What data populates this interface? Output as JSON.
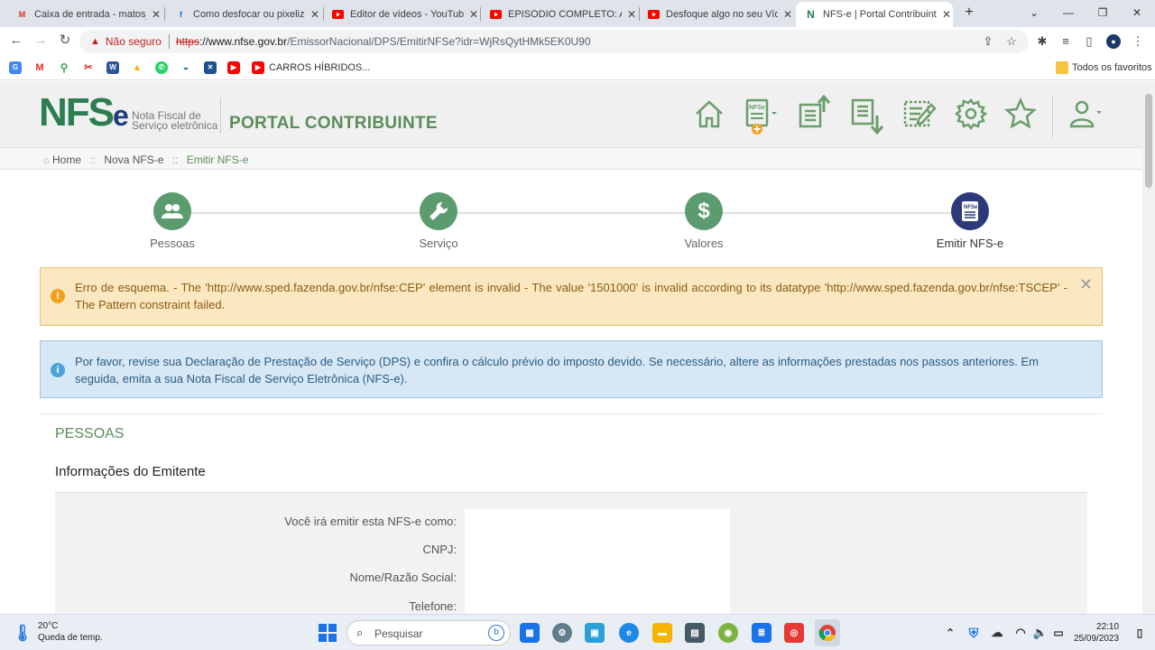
{
  "browser": {
    "tabs": [
      {
        "title": "Caixa de entrada - matosja",
        "icon": "gmail-icon",
        "color": "#d93025"
      },
      {
        "title": "Como desfocar ou pixeliza",
        "icon": "facebook-icon",
        "color": "#1877f2"
      },
      {
        "title": "Editor de vídeos - YouTube",
        "icon": "youtube-icon",
        "color": "#ff0000"
      },
      {
        "title": "EPISÓDIO COMPLETO: AS",
        "icon": "youtube-icon",
        "color": "#ff0000"
      },
      {
        "title": "Desfoque algo no seu Víde",
        "icon": "youtube-icon",
        "color": "#ff0000"
      },
      {
        "title": "NFS-e | Portal Contribuinte",
        "icon": "nfse-icon",
        "color": "#2d7d52"
      }
    ],
    "security_label": "Não seguro",
    "url_scheme": "https",
    "url_host": "://www.nfse.gov.br",
    "url_path": "/EmissorNacional/DPS/EmitirNFSe?idr=WjRsQytHMk5EK0U90",
    "bookmarks_folder_label": "CARROS HÍBRIDOS...",
    "all_bookmarks_label": "Todos os favoritos"
  },
  "header": {
    "logo_text": "NFS",
    "logo_e": "e",
    "logo_sub_line1": "Nota Fiscal de",
    "logo_sub_line2": "Serviço eletrônica",
    "portal_title": "PORTAL CONTRIBUINTE",
    "nfse_badge": "NFSe"
  },
  "breadcrumb": {
    "home": "Home",
    "sep": "::",
    "nova": "Nova NFS-e",
    "current": "Emitir NFS-e"
  },
  "steps": [
    {
      "label": "Pessoas",
      "icon": "users-icon"
    },
    {
      "label": "Serviço",
      "icon": "wrench-icon"
    },
    {
      "label": "Valores",
      "icon": "dollar-icon"
    },
    {
      "label": "Emitir NFS-e",
      "icon": "nfse-doc-icon",
      "current": true
    }
  ],
  "error_alert": {
    "text": "Erro de esquema. - The 'http://www.sped.fazenda.gov.br/nfse:CEP' element is invalid - The value '1501000' is invalid according to its datatype 'http://www.sped.fazenda.gov.br/nfse:TSCEP' - The Pattern constraint failed."
  },
  "info_alert": {
    "text": "Por favor, revise sua Declaração de Prestação de Serviço (DPS) e confira o cálculo prévio do imposto devido. Se necessário, altere as informações prestadas nos passos anteriores. Em seguida, emita a sua Nota Fiscal de Serviço Eletrônica (NFS-e)."
  },
  "section": {
    "title": "PESSOAS",
    "subtitle": "Informações do Emitente",
    "fields": [
      {
        "label": "Você irá emitir esta NFS-e como:"
      },
      {
        "label": "CNPJ:"
      },
      {
        "label": "Nome/Razão Social:"
      },
      {
        "label": "Telefone:"
      }
    ]
  },
  "taskbar": {
    "temp": "20°C",
    "weather": "Queda de temp.",
    "search_placeholder": "Pesquisar",
    "time": "22:10",
    "date": "25/09/2023"
  }
}
